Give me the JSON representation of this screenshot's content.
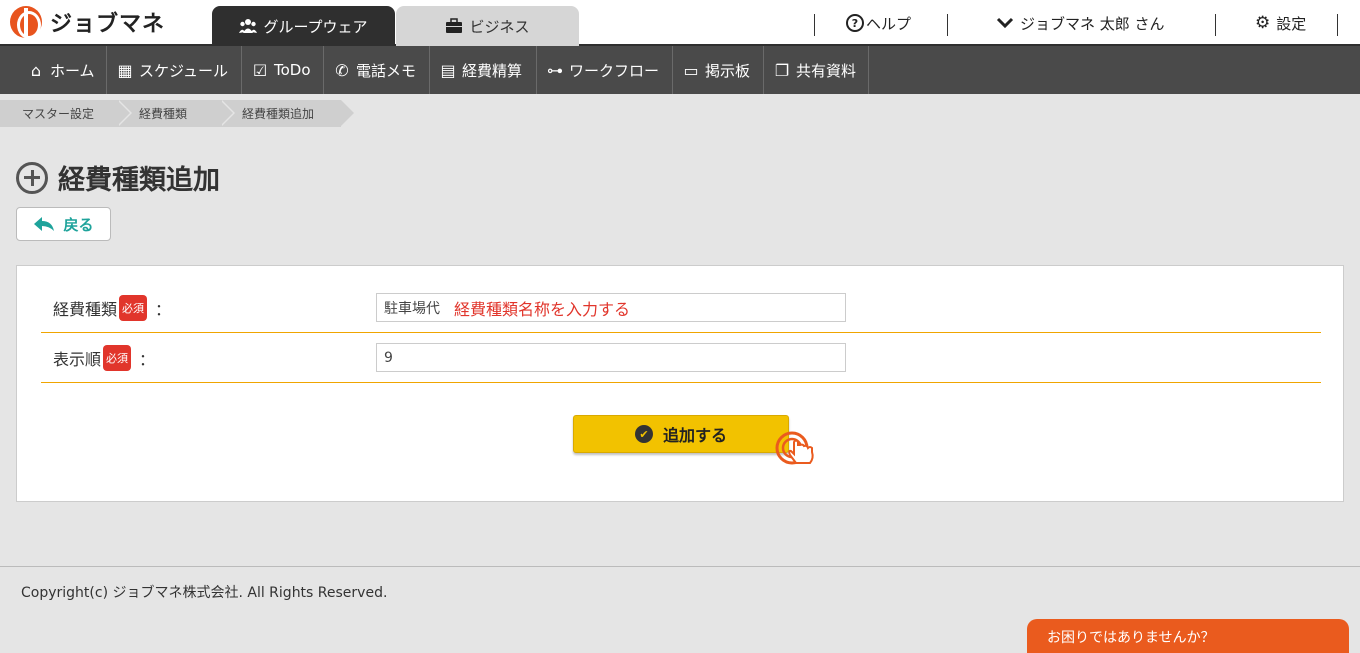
{
  "app": {
    "logo_text": "ジョブマネ"
  },
  "top_tabs": [
    {
      "label": "グループウェア",
      "icon": "users-icon",
      "active": true
    },
    {
      "label": "ビジネス",
      "icon": "briefcase-icon",
      "active": false
    }
  ],
  "header": {
    "help_label": "ヘルプ",
    "user_label": "ジョブマネ 太郎 さん",
    "settings_label": "設定"
  },
  "nav": [
    {
      "label": "ホーム",
      "icon": "home-icon"
    },
    {
      "label": "スケジュール",
      "icon": "calendar-icon"
    },
    {
      "label": "ToDo",
      "icon": "checklist-icon"
    },
    {
      "label": "電話メモ",
      "icon": "phone-icon"
    },
    {
      "label": "経費精算",
      "icon": "calculator-icon"
    },
    {
      "label": "ワークフロー",
      "icon": "workflow-icon"
    },
    {
      "label": "掲示板",
      "icon": "board-icon"
    },
    {
      "label": "共有資料",
      "icon": "documents-icon"
    }
  ],
  "breadcrumb": [
    "マスター設定",
    "経費種類",
    "経費種類追加"
  ],
  "page": {
    "title": "経費種類追加",
    "back_label": "戻る"
  },
  "form": {
    "required_badge": "必須",
    "colon": "：",
    "expense_type": {
      "label": "経費種類",
      "value": "駐車場代",
      "hint": "経費種類名称を入力する"
    },
    "display_order": {
      "label": "表示順",
      "value": "9"
    },
    "submit_label": "追加する"
  },
  "footer": {
    "copyright": "Copyright(c) ジョブマネ株式会社. All Rights Reserved.",
    "help_chat": "お困りではありませんか？"
  },
  "colors": {
    "accent_orange": "#ea5b1e",
    "button_yellow": "#f2c200",
    "required_red": "#e1352b",
    "nav_dark": "#4a4a4a",
    "back_teal": "#1ea39b"
  }
}
